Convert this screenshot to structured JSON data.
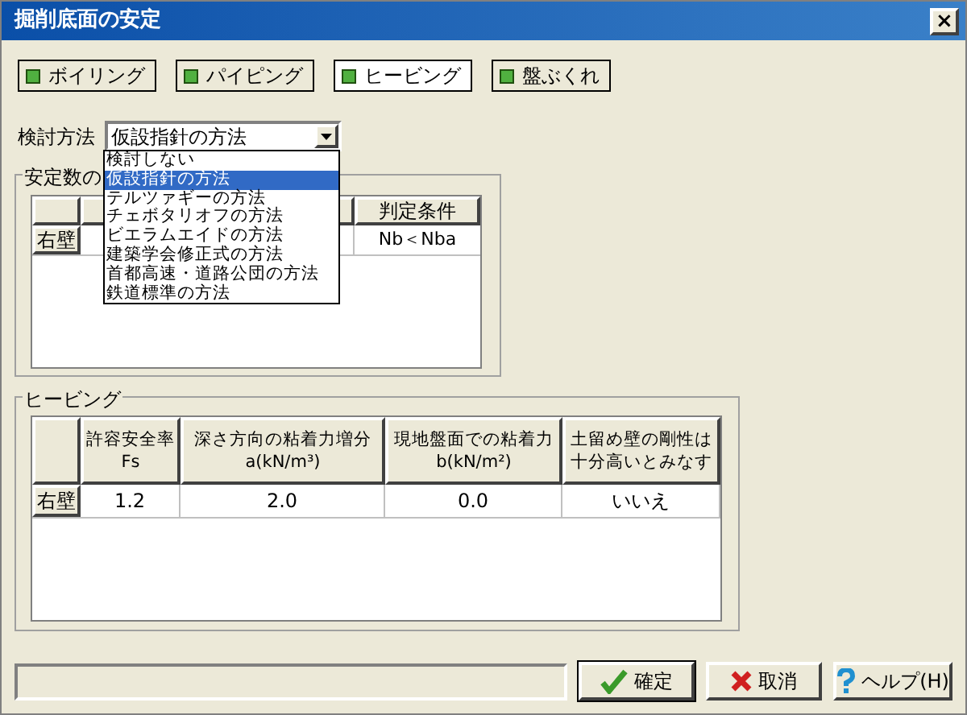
{
  "window": {
    "title": "掘削底面の安定",
    "close": "×"
  },
  "tabs": [
    {
      "label": "ボイリング",
      "selected": false
    },
    {
      "label": "パイピング",
      "selected": false
    },
    {
      "label": "ヒービング",
      "selected": true
    },
    {
      "label": "盤ぶくれ",
      "selected": false
    }
  ],
  "method": {
    "label": "検討方法",
    "value": "仮設指針の方法",
    "expanded": true,
    "options": [
      {
        "label": "検討しない",
        "selected": false
      },
      {
        "label": "仮設指針の方法",
        "selected": true
      },
      {
        "label": "テルツァギーの方法",
        "selected": false
      },
      {
        "label": "チェボタリオフの方法",
        "selected": false
      },
      {
        "label": "ビエラムエイドの方法",
        "selected": false
      },
      {
        "label": "建築学会修正式の方法",
        "selected": false
      },
      {
        "label": "首都高速・道路公団の方法",
        "selected": false
      },
      {
        "label": "鉄道標準の方法",
        "selected": false
      }
    ]
  },
  "stability_group": {
    "title": "安定数の",
    "judgement_column": "判定条件",
    "rows": [
      {
        "label": "右壁",
        "judgement": "Nb＜Nba"
      }
    ]
  },
  "heaving_group": {
    "title": "ヒービング",
    "columns": [
      {
        "title": "許容安全率",
        "subtitle": "Fs"
      },
      {
        "title": "深さ方向の粘着力増分",
        "subtitle": "a(kN/m³)"
      },
      {
        "title": "現地盤面での粘着力",
        "subtitle": "b(kN/m²)"
      },
      {
        "title": "土留め壁の剛性は",
        "subtitle": "十分高いとみなす"
      }
    ],
    "rows": [
      {
        "label": "右壁",
        "cells": [
          "1.2",
          "2.0",
          "0.0",
          "いいえ"
        ]
      }
    ]
  },
  "buttons": [
    {
      "kind": "ok",
      "label": "確定"
    },
    {
      "kind": "cancel",
      "label": "取消"
    },
    {
      "kind": "help",
      "label": "ヘルプ(H)"
    }
  ]
}
